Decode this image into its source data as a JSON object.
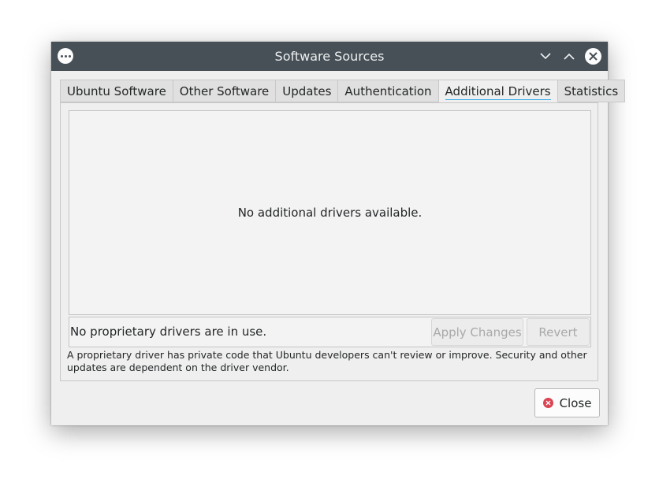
{
  "window": {
    "title": "Software Sources"
  },
  "tabs": [
    {
      "label": "Ubuntu Software"
    },
    {
      "label": "Other Software"
    },
    {
      "label": "Updates"
    },
    {
      "label": "Authentication"
    },
    {
      "label": "Additional Drivers",
      "active": true
    },
    {
      "label": "Statistics"
    }
  ],
  "drivers": {
    "empty_message": "No additional drivers available.",
    "status": "No proprietary drivers are in use.",
    "apply_label": "Apply Changes",
    "revert_label": "Revert",
    "info": "A proprietary driver has private code that Ubuntu developers can't review or improve. Security and other updates are dependent on the driver vendor."
  },
  "footer": {
    "close_label": "Close"
  },
  "colors": {
    "titlebar": "#475057",
    "accent": "#3daee9",
    "close_icon": "#da4453"
  },
  "icons": {
    "window_menu": "menu-dots-icon",
    "minimize": "chevron-down-icon",
    "maximize": "chevron-up-icon",
    "close": "close-icon"
  }
}
